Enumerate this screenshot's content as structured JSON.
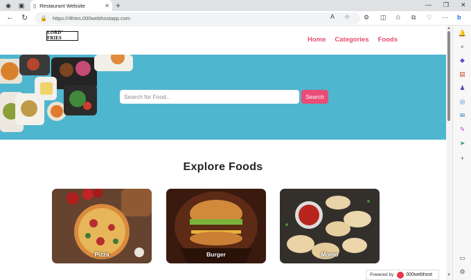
{
  "browser": {
    "tab_title": "Restaurant Website",
    "tab_close": "✕",
    "new_tab": "+",
    "url": "https://4fries.000webhostapp.com",
    "window_min": "—",
    "window_max": "❐",
    "window_close": "✕"
  },
  "site": {
    "logo_text": "LORD’ FRIES",
    "nav": [
      "Home",
      "Categories",
      "Foods"
    ],
    "search": {
      "placeholder": "Search for Food..",
      "button_label": "Search"
    },
    "section_title": "Explore Foods",
    "categories": [
      {
        "label": "Pizza",
        "color": "#7a4a2e"
      },
      {
        "label": "Burger",
        "color": "#5c2a16"
      },
      {
        "label": "Momo",
        "color": "#3e3a36"
      }
    ],
    "powered_by": "Powered by",
    "host_name": "000webhost"
  },
  "colors": {
    "hero_bg": "#4fb6cf",
    "accent": "#ea4c75"
  }
}
